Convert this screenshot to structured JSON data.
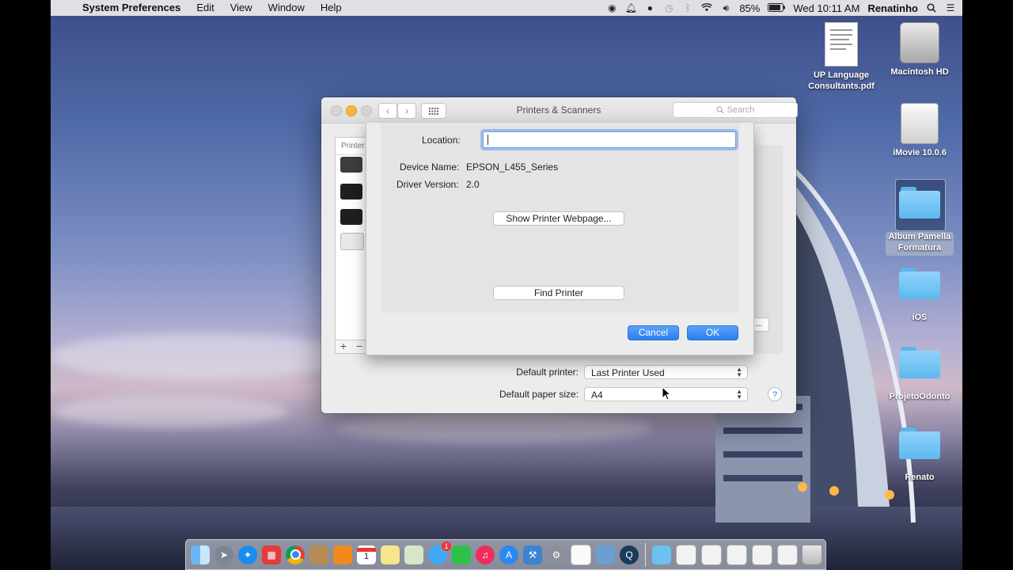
{
  "menubar": {
    "app_name": "System Preferences",
    "menus": [
      "Edit",
      "View",
      "Window",
      "Help"
    ],
    "battery": "85%",
    "clock": "Wed 10:11 AM",
    "user": "Renatinho"
  },
  "window": {
    "title": "Printers & Scanners",
    "search_placeholder": "Search",
    "printer_list_header": "Printer",
    "options_button_label": "...",
    "add_label": "+",
    "remove_label": "−",
    "default_printer_label": "Default printer:",
    "default_printer_value": "Last Printer Used",
    "default_paper_label": "Default paper size:",
    "default_paper_value": "A4",
    "help_label": "?"
  },
  "sheet": {
    "location_label": "Location:",
    "location_value": "",
    "device_name_label": "Device Name:",
    "device_name_value": "EPSON_L455_Series",
    "driver_version_label": "Driver Version:",
    "driver_version_value": "2.0",
    "show_webpage_button": "Show Printer Webpage...",
    "find_printer_button": "Find Printer",
    "cancel_button": "Cancel",
    "ok_button": "OK"
  },
  "desktop": {
    "icons": [
      {
        "label": "UP Language Consultants.pdf",
        "icon": "pdf-document-icon"
      },
      {
        "label": "Macintosh HD",
        "icon": "hard-drive-icon"
      },
      {
        "label": "iMovie 10.0.6",
        "icon": "disk-image-icon"
      },
      {
        "label": "Album Pamella Formatura",
        "icon": "folder-icon"
      },
      {
        "label": "iOS",
        "icon": "folder-icon"
      },
      {
        "label": "ProjetoOdonto",
        "icon": "folder-icon"
      },
      {
        "label": "Renato",
        "icon": "folder-icon"
      }
    ]
  },
  "dock": {
    "apps": [
      "finder",
      "launchpad",
      "safari",
      "photo-booth",
      "chrome",
      "contacts",
      "ibooks",
      "calendar",
      "notes",
      "preview",
      "messages",
      "facetime",
      "itunes",
      "app-store",
      "xcode",
      "system-preferences",
      "textedit",
      "image-viewer",
      "quicktime"
    ],
    "calendar_day": "1",
    "messages_badge": "1"
  },
  "colors": {
    "accent": "#2a7ef0",
    "folder": "#6cc1f2"
  }
}
